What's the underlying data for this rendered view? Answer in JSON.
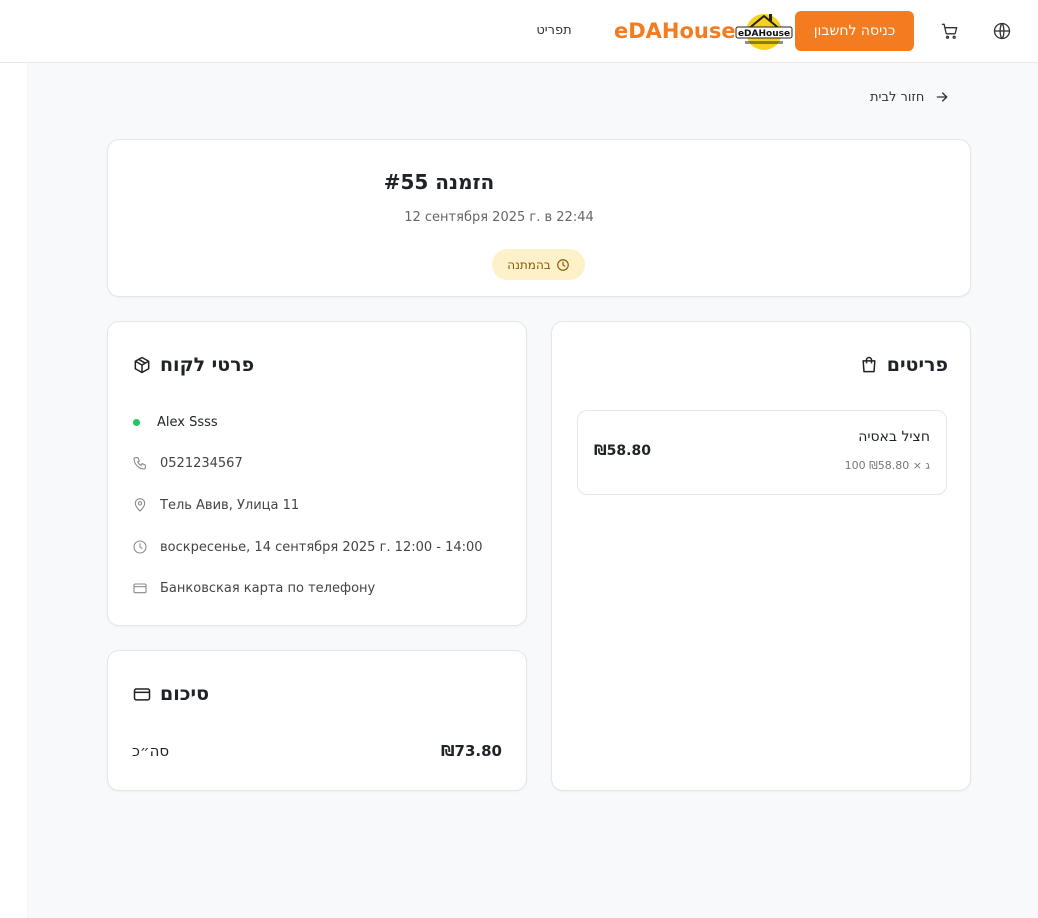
{
  "header": {
    "brand": "eDAHouse",
    "login_label": "כניסה לחשבון",
    "menu_label": "תפריט",
    "logo_text": "eDAHouse"
  },
  "back_link": {
    "label": "חזור לבית"
  },
  "order": {
    "title": "הזמנה #55",
    "date": "12 сентября 2025 г. в 22:44",
    "status": "בהמתנה",
    "status_color": "#fdf1c9"
  },
  "customer": {
    "heading": "פרטי לקוח",
    "name": "Alex Ssss",
    "phone": "0521234567",
    "address": "Тель Авив, Улица 11",
    "delivery_time": "воскресенье, 14 сентября 2025 г. 12:00 - 14:00",
    "payment": "Банковская карта по телефону"
  },
  "summary": {
    "heading": "סיכום",
    "total_label": "סה״כ",
    "total_value": "₪73.80"
  },
  "items": {
    "heading": "פריטים",
    "list": [
      {
        "name": "חציל באסיה",
        "meta": "100 ג × ₪58.80",
        "price": "₪58.80"
      }
    ]
  },
  "colors": {
    "accent": "#f27c1f",
    "online_dot": "#22c55e"
  }
}
